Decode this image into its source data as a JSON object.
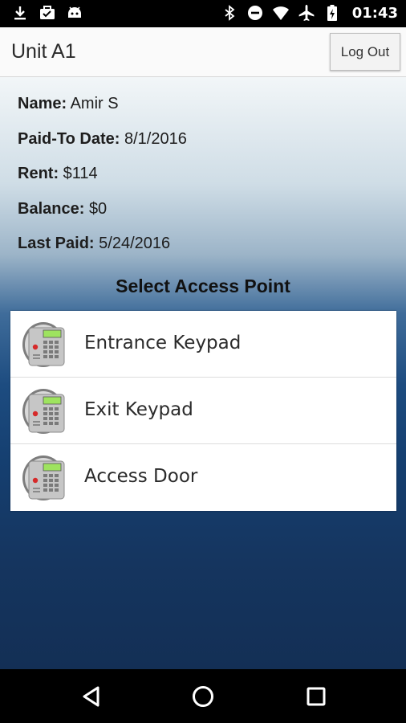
{
  "status_bar": {
    "time": "01:43",
    "left_icons": [
      "download-icon",
      "briefcase-check-icon",
      "android-icon"
    ],
    "right_icons": [
      "bluetooth-icon",
      "do-not-disturb-icon",
      "wifi-icon",
      "airplane-icon",
      "battery-charging-icon"
    ]
  },
  "header": {
    "title": "Unit A1",
    "logout_label": "Log Out"
  },
  "tenant": {
    "name_label": "Name:",
    "name_value": "Amir S",
    "paid_to_label": "Paid-To Date:",
    "paid_to_value": "8/1/2016",
    "rent_label": "Rent:",
    "rent_value": "$114",
    "balance_label": "Balance:",
    "balance_value": "$0",
    "last_paid_label": "Last Paid:",
    "last_paid_value": "5/24/2016"
  },
  "access": {
    "heading": "Select Access Point",
    "items": [
      {
        "label": "Entrance Keypad",
        "icon": "keypad-icon"
      },
      {
        "label": "Exit Keypad",
        "icon": "keypad-icon"
      },
      {
        "label": "Access Door",
        "icon": "keypad-icon"
      }
    ]
  },
  "nav": {
    "buttons": [
      "back-icon",
      "home-icon",
      "recents-icon"
    ]
  },
  "colors": {
    "header_bg": "#fafafa",
    "gradient_top": "#f2f6f8",
    "gradient_bottom": "#132f55",
    "list_bg": "#ffffff"
  }
}
